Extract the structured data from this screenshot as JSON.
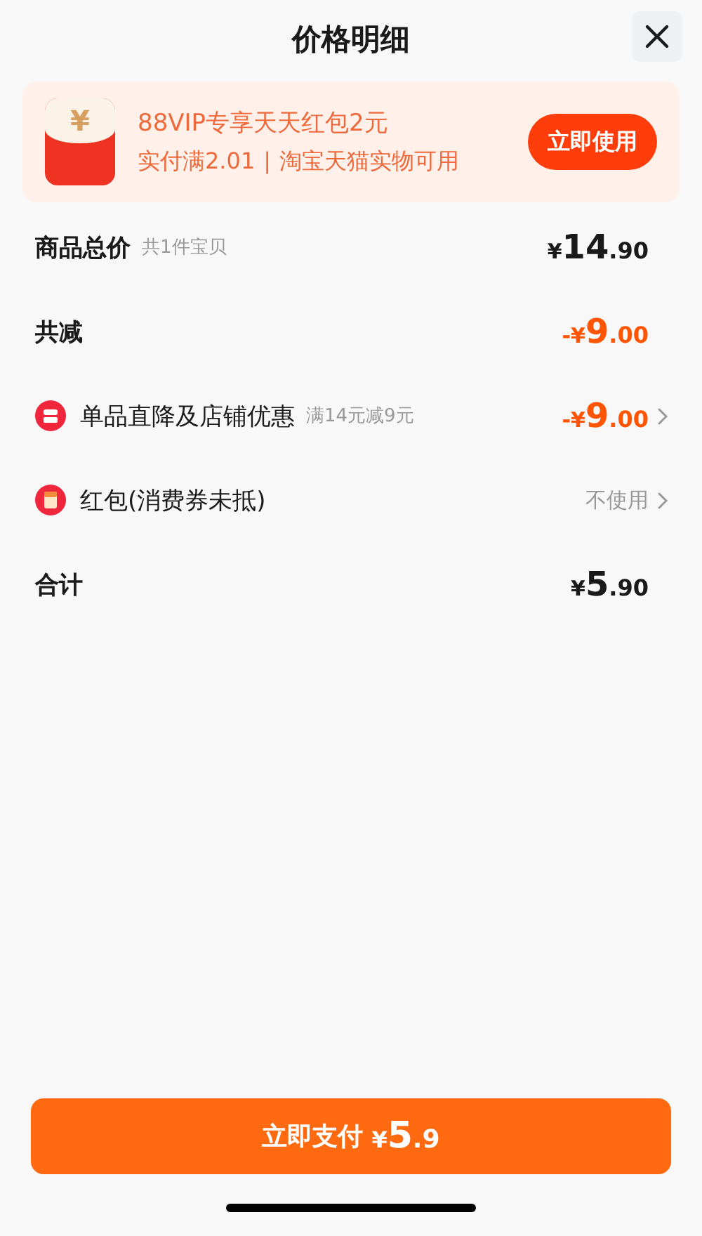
{
  "title": "价格明细",
  "banner": {
    "headline": "88VIP专享天天红包2元",
    "condition": "实付满2.01",
    "scope": "淘宝天猫实物可用",
    "separator": "|",
    "currency_mark": "¥",
    "button": "立即使用"
  },
  "rows": [
    {
      "kind": "summary",
      "label": "商品总价",
      "note": "共1件宝贝",
      "amount": {
        "prefix": "¥",
        "main": "14",
        "fraction": ".90"
      },
      "color": "#1a1a1a"
    },
    {
      "kind": "summary",
      "label": "共减",
      "amount": {
        "prefix": "-¥",
        "main": "9",
        "fraction": ".00"
      },
      "color": "#ff5500"
    },
    {
      "kind": "discount",
      "label": "单品直降及店铺优惠",
      "note": "满14元减9元",
      "amount": {
        "prefix": "-¥",
        "main": "9",
        "fraction": ".00"
      },
      "color": "#ff5500"
    },
    {
      "kind": "red_packet",
      "label": "红包(消费券未抵)",
      "value": "不使用"
    },
    {
      "kind": "summary",
      "label": "合计",
      "amount": {
        "prefix": "¥",
        "main": "5",
        "fraction": ".90"
      },
      "color": "#1a1a1a"
    }
  ],
  "pay_button": {
    "label": "立即支付",
    "amount": {
      "prefix": "¥",
      "main": "5",
      "fraction": ".9"
    }
  }
}
